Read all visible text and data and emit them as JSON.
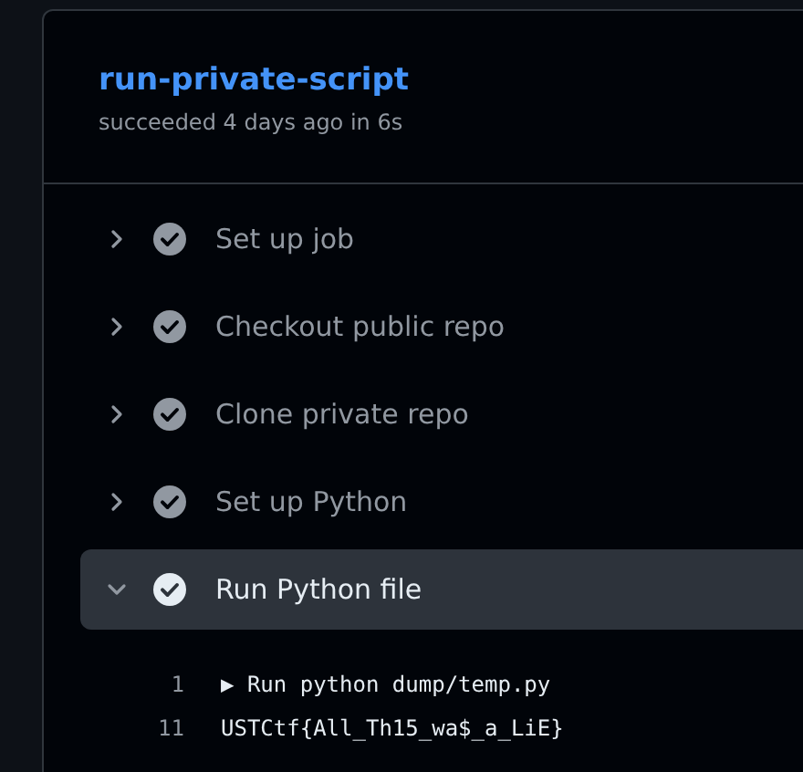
{
  "job": {
    "title": "run-private-script",
    "status": "succeeded 4 days ago in 6s"
  },
  "steps": [
    {
      "name": "Set up job",
      "expanded": false
    },
    {
      "name": "Checkout public repo",
      "expanded": false
    },
    {
      "name": "Clone private repo",
      "expanded": false
    },
    {
      "name": "Set up Python",
      "expanded": false
    },
    {
      "name": "Run Python file",
      "expanded": true,
      "log": [
        {
          "line": "1",
          "text": "▶ Run python dump/temp.py"
        },
        {
          "line": "11",
          "text": "USTCtf{All_Th15_wa$_a_LiE}"
        }
      ]
    }
  ]
}
